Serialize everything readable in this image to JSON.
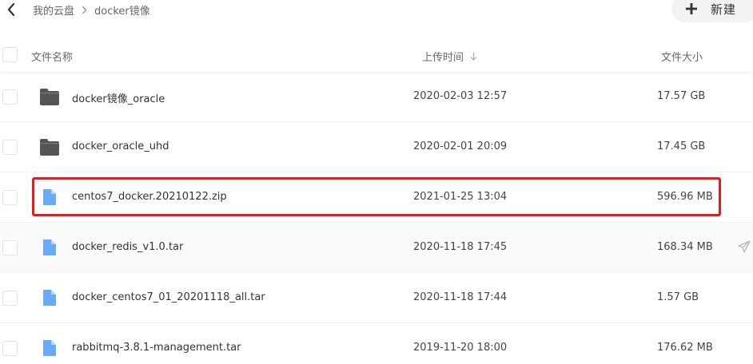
{
  "breadcrumb": {
    "items": [
      "我的云盘",
      "docker镜像"
    ]
  },
  "toolbar": {
    "new_label": "新建"
  },
  "columns": {
    "name": "文件名称",
    "time": "上传时间",
    "size": "文件大小"
  },
  "files": [
    {
      "name": "docker镜像_oracle",
      "time": "2020-02-03 12:57",
      "size": "17.57 GB",
      "type": "folder"
    },
    {
      "name": "docker_oracle_uhd",
      "time": "2020-02-01 20:09",
      "size": "17.45 GB",
      "type": "folder"
    },
    {
      "name": "centos7_docker.20210122.zip",
      "time": "2021-01-25 13:04",
      "size": "596.96 MB",
      "type": "file"
    },
    {
      "name": "docker_redis_v1.0.tar",
      "time": "2020-11-18 17:45",
      "size": "168.34 MB",
      "type": "file"
    },
    {
      "name": "docker_centos7_01_20201118_all.tar",
      "time": "2020-11-18 17:44",
      "size": "1.57 GB",
      "type": "file"
    },
    {
      "name": "rabbitmq-3.8.1-management.tar",
      "time": "2019-11-20 18:00",
      "size": "176.62 MB",
      "type": "file"
    }
  ],
  "icons": {
    "back": "chevron-left-icon",
    "separator": "chevron-right-icon",
    "new": "plus-icon",
    "sort": "arrow-down-icon",
    "folder": "folder-icon",
    "file": "document-icon",
    "share": "paper-plane-icon"
  },
  "colors": {
    "folder": "#555555",
    "file": "#6aa9f5",
    "highlight": "#e02020"
  }
}
